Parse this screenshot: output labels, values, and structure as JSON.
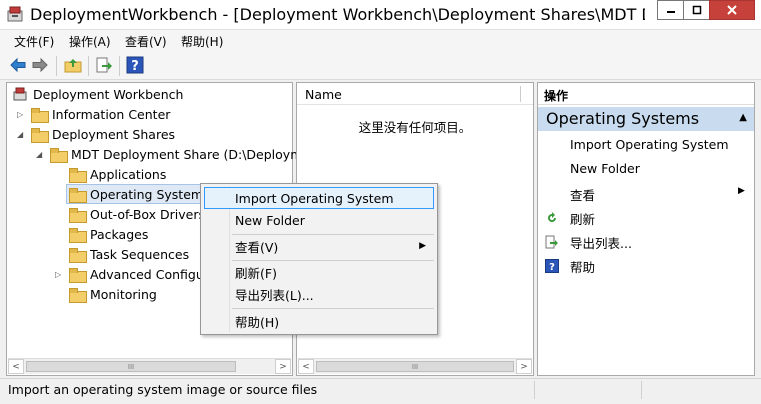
{
  "window": {
    "title": "DeploymentWorkbench - [Deployment Workbench\\Deployment Shares\\MDT Deplo..."
  },
  "menu": [
    "文件(F)",
    "操作(A)",
    "查看(V)",
    "帮助(H)"
  ],
  "toolbar_icons": [
    "back-arrow-icon",
    "forward-arrow-icon",
    "up-folder-icon",
    "export-icon",
    "help-icon"
  ],
  "tree": {
    "root": "Deployment Workbench",
    "information_center": "Information Center",
    "deployment_shares": "Deployment Shares",
    "share": "MDT Deployment Share (D:\\Deployme",
    "children": [
      "Applications",
      "Operating Systems",
      "Out-of-Box Drivers",
      "Packages",
      "Task Sequences",
      "Advanced Configur",
      "Monitoring"
    ]
  },
  "list": {
    "column_name": "Name",
    "empty_text": "这里没有任何项目。"
  },
  "actions": {
    "header": "操作",
    "group": "Operating Systems",
    "items": [
      "Import Operating System",
      "New Folder",
      "查看",
      "刷新",
      "导出列表...",
      "帮助"
    ]
  },
  "context_menu": {
    "items": [
      "Import Operating System",
      "New Folder",
      "查看(V)",
      "刷新(F)",
      "导出列表(L)...",
      "帮助(H)"
    ],
    "highlighted_index": 0
  },
  "status": {
    "text": "Import an operating system image or source files"
  },
  "colors": {
    "close_button": "#c7413b",
    "selection": "#3399ff",
    "actions_group_bg": "#c9dcef"
  }
}
